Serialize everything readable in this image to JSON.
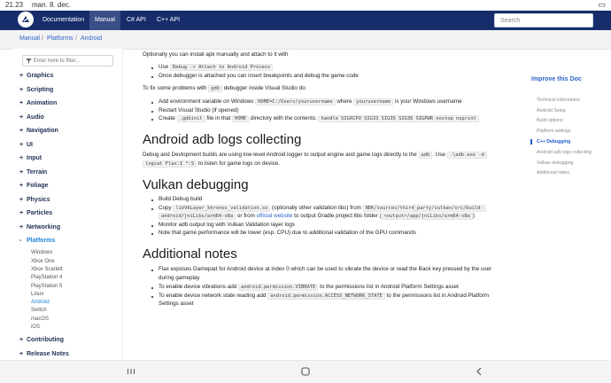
{
  "status": {
    "time": "21.23",
    "date": "man. 8. dec.",
    "indicator": "▭"
  },
  "nav": {
    "items": [
      "Documentation",
      "Manual",
      "C# API",
      "C++ API"
    ],
    "active": "Manual",
    "search_placeholder": "Search"
  },
  "breadcrumb": [
    "Manual",
    "Platforms",
    "Android"
  ],
  "sidebar": {
    "filter_placeholder": "Enter here to filter...",
    "items": [
      "Graphics",
      "Scripting",
      "Animation",
      "Audio",
      "Navigation",
      "UI",
      "Input",
      "Terrain",
      "Foliage",
      "Physics",
      "Particles",
      "Networking",
      "Platforms",
      "Contributing",
      "Release Notes"
    ],
    "platforms_children": [
      "Windows",
      "Xbox One",
      "Xbox Scarlett",
      "PlayStation 4",
      "PlayStation 5",
      "Linux",
      "Android",
      "Switch",
      "macOS",
      "iOS"
    ],
    "active_child": "Android"
  },
  "content": {
    "intro": "Optionally you can install apk manually and attach to it with",
    "attach_li1_pre": "Use ",
    "attach_li1_code": "Debug -> Attach to Android Process",
    "attach_li2": "Once debugger is attached you can insert breakpoints and debug the game code",
    "fix_pre": "To fix some problems with ",
    "fix_code": "gdb",
    "fix_post": " debugger inside Visual Studio do:",
    "fix_li1_a": "Add environment variable on Windows ",
    "fix_li1_code1": "HOME=C:/Users/yourusername",
    "fix_li1_b": " where ",
    "fix_li1_code2": "yourusername",
    "fix_li1_c": " is your Windows username",
    "fix_li2": "Restart Visual Studio (if opened)",
    "fix_li3_a": "Create ",
    "fix_li3_code1": ".gdbinit",
    "fix_li3_b": " file in that ",
    "fix_li3_code2": "HOME",
    "fix_li3_c": " directory with the contents: ",
    "fix_li3_code3": "handle SIGXCPU SIG33 SIG35 SIG36 SIGPWR nostop noprint",
    "h_logs": "Android adb logs collecting",
    "logs_a": "Debug and Devlopment builds are using low-level Android logger to output engine and game logs directly to the ",
    "logs_code1": "adb",
    "logs_b": ". Use ",
    "logs_code2": ".\\adb.exe -d",
    "logs_code3": "logcat Flax:I *:S",
    "logs_c": " to listen for game logs on device.",
    "h_vulkan": "Vulkan debugging",
    "vk_li1": "Build Debug build",
    "vk_li2_a": "Copy ",
    "vk_li2_code1": "libVkLayer_khronos_validation.so",
    "vk_li2_b": " (optionally other validation libs) from ",
    "vk_li2_code2": "NDK/sources/third_party/vulkan/src/build-",
    "vk_li2_code3": "android/jniLibs/arm64-v8a",
    "vk_li2_c": " or from ",
    "vk_li2_link": "official website",
    "vk_li2_d": " to output Gradle project libs folder (",
    "vk_li2_code4": "<output>/app/jniLibs/arm64-v8a",
    "vk_li2_e": ")",
    "vk_li3": "Monitor adb output log with Vulkan Validation layer logs",
    "vk_li4": "Note that game performance will be lower (esp. CPU) due to additional validation of the GPU commands",
    "h_notes": "Additional notes",
    "n_li1a": "Flax exposes Gamepad for Android device at index 0 which can be used to vibrate the device or read the Back key pressed by the user",
    "n_li1b": "during gameplay",
    "n_li2_a": "To enable device vibrations add ",
    "n_li2_code": "android.permission.VIBRATE",
    "n_li2_b": " to the permissions list in Android Platform Settings asset",
    "n_li3_a": "To enable device network state reading add ",
    "n_li3_code": "android.permission.ACCESS_NETWORK_STATE",
    "n_li3_b": " to the permissions list in Android Platform",
    "n_li3_c": "Settings asset"
  },
  "toc": {
    "title": "Improve this Doc",
    "items": [
      "Technical information",
      "Android Setup",
      "Build options",
      "Platform settings",
      "C++ Debugging",
      "Android adb logs collecting",
      "Vulkan debugging",
      "Additional notes"
    ],
    "active": "C++ Debugging"
  },
  "colors": {
    "nav_bg": "#172d6b",
    "accent": "#1e82d6",
    "link": "#2e64c9"
  }
}
